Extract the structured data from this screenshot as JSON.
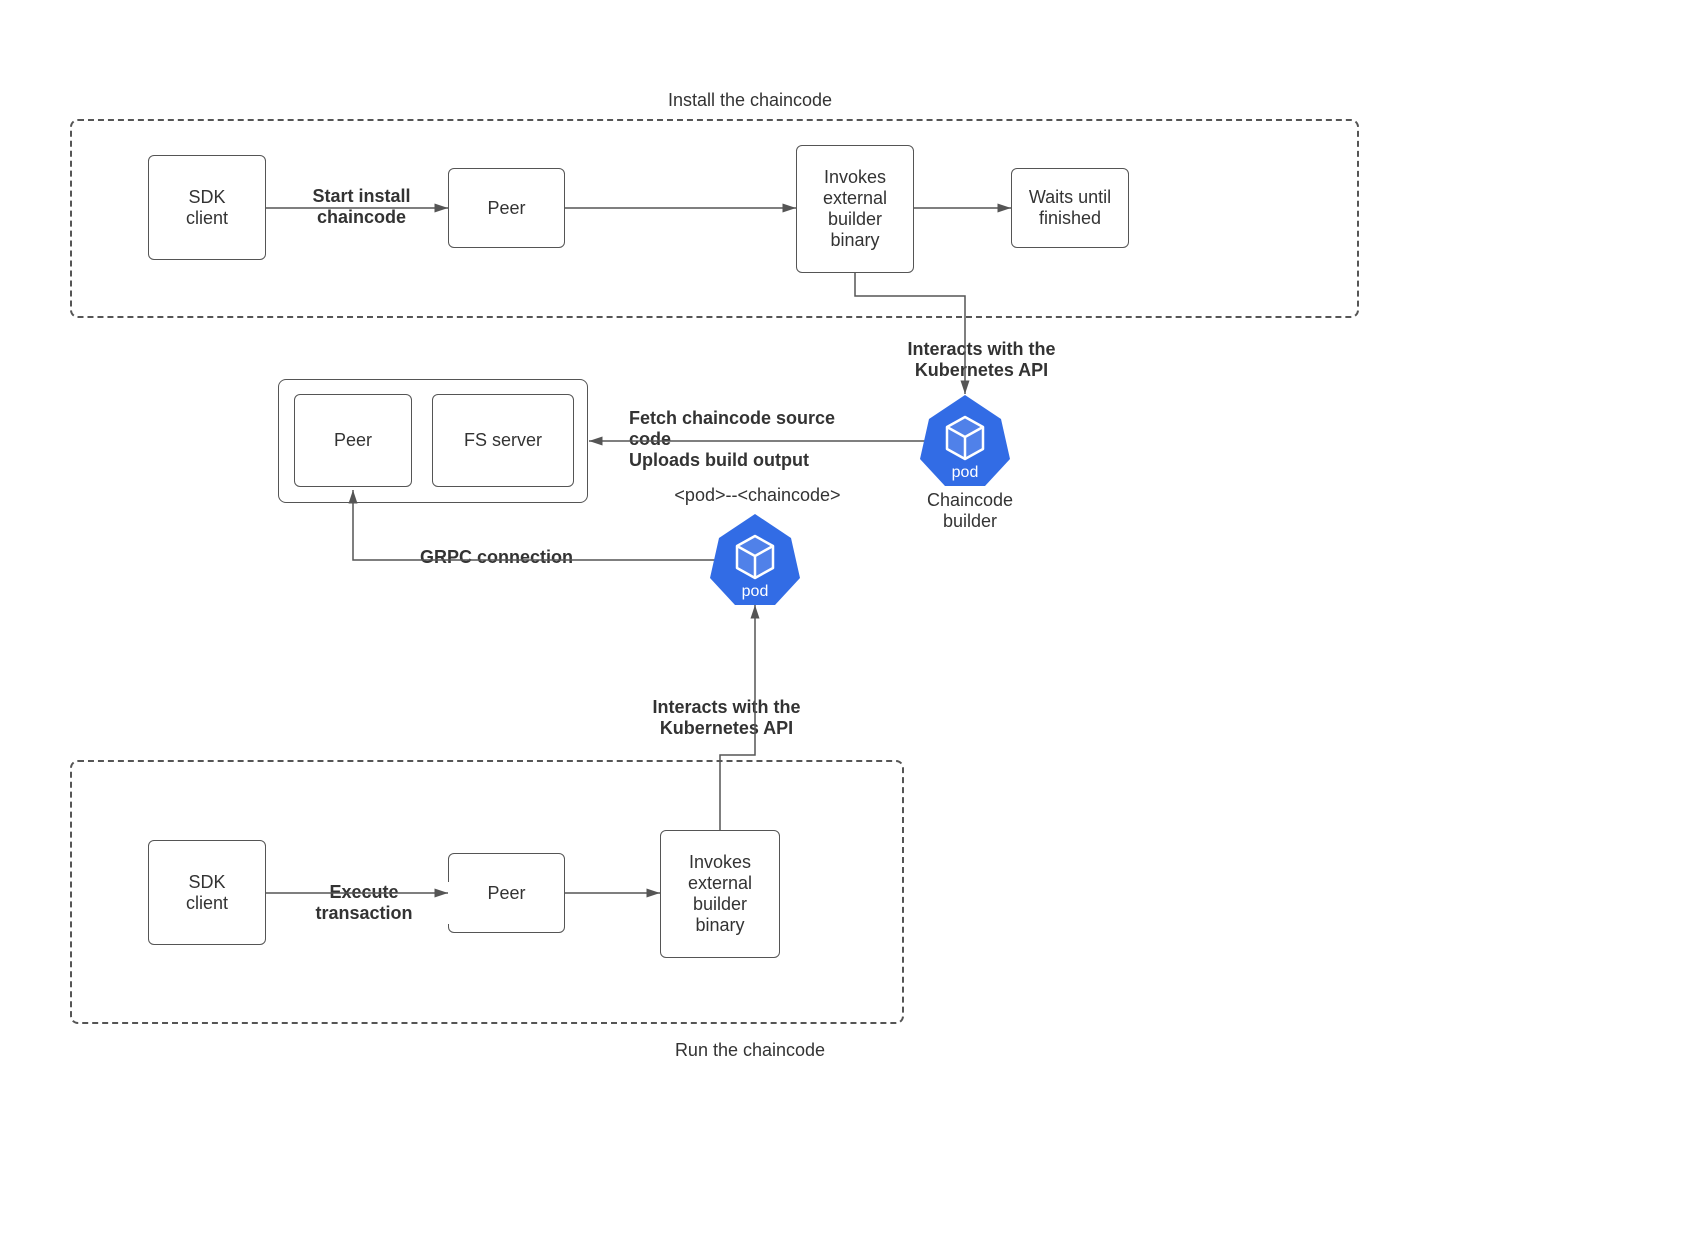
{
  "titles": {
    "install": "Install the chaincode",
    "run": "Run the chaincode"
  },
  "nodes": {
    "sdk1": "SDK\nclient",
    "peer1": "Peer",
    "invokes1": "Invokes\nexternal\nbuilder\nbinary",
    "waits": "Waits until\nfinished",
    "peer_mid": "Peer",
    "fs_server": "FS server",
    "builder_label": "Chaincode\nbuilder",
    "pod_chaincode_label": "<pod>--<chaincode>",
    "sdk2": "SDK\nclient",
    "peer2": "Peer",
    "invokes2": "Invokes\nexternal\nbuilder\nbinary"
  },
  "edges": {
    "start_install": "Start install\nchaincode",
    "k8s_api": "Interacts with the\nKubernetes API",
    "fetch_upload": "Fetch chaincode source code\nUploads build output",
    "grpc": "GRPC connection",
    "exec_tx": "Execute transaction",
    "k8s_api_2": "Interacts with the\nKubernetes API"
  },
  "icons": {
    "pod_text": "pod"
  }
}
